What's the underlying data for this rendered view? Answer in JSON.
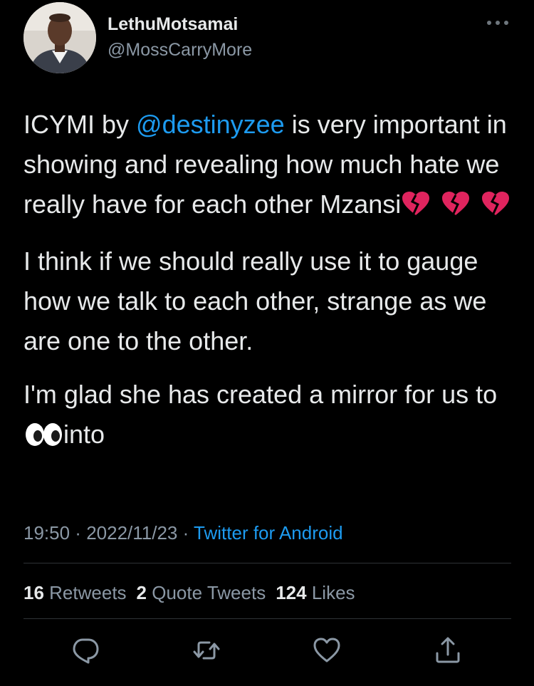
{
  "author": {
    "display_name": "LethuMotsamai",
    "handle": "@MossCarryMore",
    "avatar_icon": "profile-photo"
  },
  "menu": {
    "icon": "more-horizontal-icon"
  },
  "tweet": {
    "p1_before": "ICYMI by ",
    "mention": "@destinyzee",
    "p1_after": " is very important in showing and revealing how much hate we really have for each other Mzansi",
    "p1_emojis": [
      "broken-heart",
      "broken-heart",
      "broken-heart"
    ],
    "p2": "I think if we should really use it to gauge how we talk to each other, strange as we are one to the other.",
    "p3_before": "I'm glad she has created a mirror for us to ",
    "p3_emoji": "eyes",
    "p3_after": "into"
  },
  "meta": {
    "time": "19:50",
    "separator": " · ",
    "date": "2022/11/23",
    "source": "Twitter for Android"
  },
  "stats": {
    "retweets_count": "16",
    "retweets_label": "Retweets",
    "quotes_count": "2",
    "quotes_label": "Quote Tweets",
    "likes_count": "124",
    "likes_label": "Likes"
  },
  "actions": {
    "icons": [
      "reply-icon",
      "retweet-icon",
      "like-icon",
      "share-icon"
    ]
  },
  "colors": {
    "background": "#000000",
    "text": "#e7e9ea",
    "secondary": "#8b98a5",
    "link": "#1d9bf0",
    "divider": "#2f3336"
  }
}
